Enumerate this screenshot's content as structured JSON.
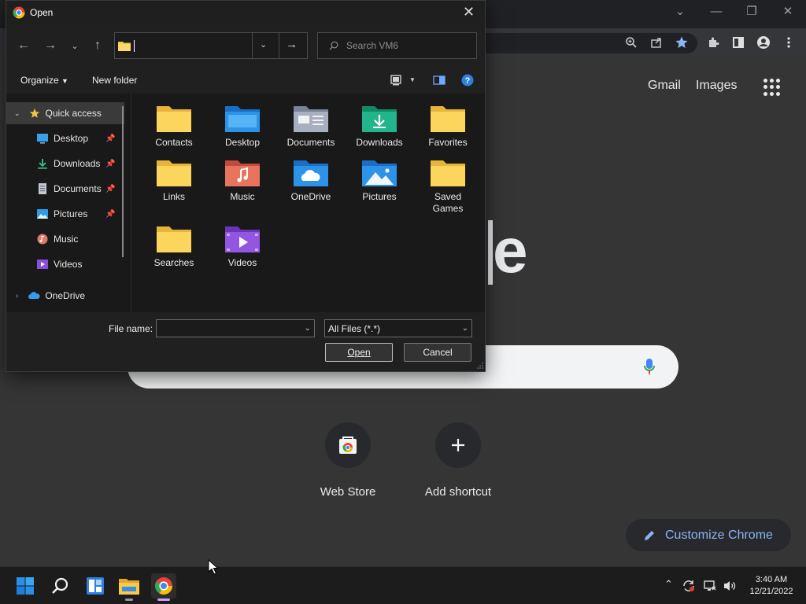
{
  "dialog": {
    "title": "Open",
    "search_placeholder": "Search VM6",
    "organize_label": "Organize",
    "new_folder_label": "New folder",
    "file_name_label": "File name:",
    "file_name_value": "",
    "file_type_value": "All Files (*.*)",
    "open_label": "Open",
    "cancel_label": "Cancel",
    "nav": {
      "quick_access": "Quick access",
      "desktop": "Desktop",
      "downloads": "Downloads",
      "documents": "Documents",
      "pictures": "Pictures",
      "music": "Music",
      "videos": "Videos",
      "onedrive": "OneDrive"
    },
    "folders": {
      "contacts": "Contacts",
      "desktop": "Desktop",
      "documents": "Documents",
      "downloads": "Downloads",
      "favorites": "Favorites",
      "links": "Links",
      "music": "Music",
      "onedrive": "OneDrive",
      "pictures": "Pictures",
      "saved_games_line1": "Saved",
      "saved_games_line2": "Games",
      "searches": "Searches",
      "videos": "Videos"
    }
  },
  "chrome": {
    "gmail": "Gmail",
    "images": "Images",
    "logo_fragment": "e",
    "web_store": "Web Store",
    "add_shortcut": "Add shortcut",
    "customize": "Customize Chrome",
    "accent": "#8ab4f8"
  },
  "taskbar": {
    "time": "3:40 AM",
    "date": "12/21/2022"
  }
}
